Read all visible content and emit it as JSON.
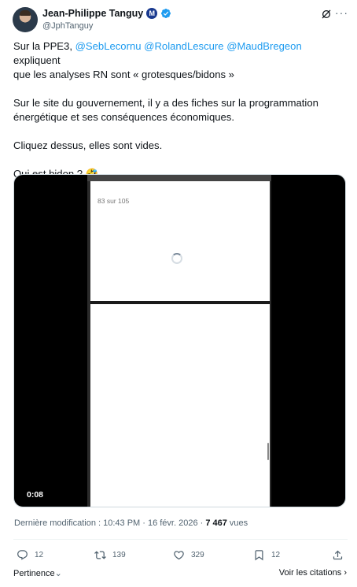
{
  "author": {
    "display_name": "Jean-Philippe Tanguy",
    "handle": "@JphTanguy",
    "party_badge": "M"
  },
  "tweet": {
    "line1_prefix": "Sur la PPE3,",
    "mention1": "@SebLecornu",
    "mention2": "@RolandLescure",
    "mention3": "@MaudBregeon",
    "line1_suffix": "expliquent",
    "line2": "que les analyses RN sont « grotesques/bidons »",
    "para2_line1": "Sur le site du gouvernement, il y a des fiches sur la programmation",
    "para2_line2": "énergétique et ses conséquences économiques.",
    "para3": "Cliquez dessus, elles sont vides.",
    "para4": "Qui est bidon ? 🤣"
  },
  "media": {
    "page_counter": "83 sur 105",
    "duration": "0:08"
  },
  "meta": {
    "prefix": "Dernière modification : 10:43 PM · 16 févr. 2026 · ",
    "views_count": "7 467",
    "views_label": " vues"
  },
  "actions": {
    "replies": "12",
    "reposts": "139",
    "likes": "329",
    "bookmarks": "12"
  },
  "footer": {
    "pertinence": "Pertinence",
    "citations": "Voir les citations"
  },
  "colors": {
    "link": "#1d9bf0",
    "secondary_text": "#536471",
    "verified": "#1d9bf0"
  }
}
